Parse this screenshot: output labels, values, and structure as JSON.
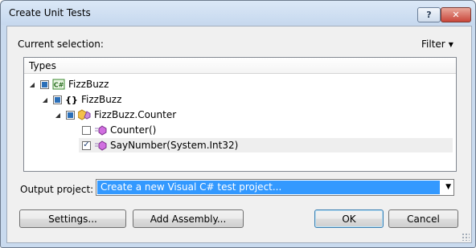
{
  "window": {
    "title": "Create Unit Tests",
    "help_label": "?",
    "close_label": "✕"
  },
  "labels": {
    "current_selection": "Current selection:",
    "filter": "Filter",
    "types_header": "Types",
    "output_project": "Output project:"
  },
  "tree": {
    "nodes": [
      {
        "label": "FizzBuzz",
        "state": "partial",
        "icon": "csharp-project-icon"
      },
      {
        "label": "FizzBuzz",
        "state": "partial",
        "icon": "namespace-icon"
      },
      {
        "label": "FizzBuzz.Counter",
        "state": "partial",
        "icon": "class-icon"
      },
      {
        "label": "Counter()",
        "state": "unchecked",
        "icon": "method-icon"
      },
      {
        "label": "SayNumber(System.Int32)",
        "state": "checked",
        "icon": "method-icon"
      }
    ]
  },
  "output_project": {
    "value": "Create a new Visual C# test project..."
  },
  "buttons": {
    "settings": "Settings...",
    "add_assembly": "Add Assembly...",
    "ok": "OK",
    "cancel": "Cancel"
  },
  "colors": {
    "selection": "#3399ff",
    "title_bar": "#c6d8ee",
    "close_button": "#c9463a"
  }
}
